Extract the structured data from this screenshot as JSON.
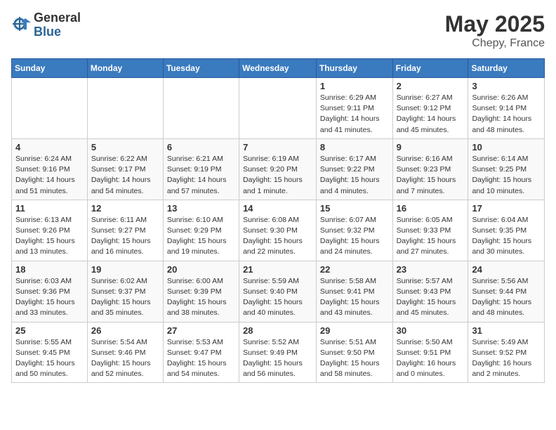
{
  "header": {
    "logo_general": "General",
    "logo_blue": "Blue",
    "month": "May 2025",
    "location": "Chepy, France"
  },
  "weekdays": [
    "Sunday",
    "Monday",
    "Tuesday",
    "Wednesday",
    "Thursday",
    "Friday",
    "Saturday"
  ],
  "weeks": [
    [
      {
        "day": "",
        "detail": ""
      },
      {
        "day": "",
        "detail": ""
      },
      {
        "day": "",
        "detail": ""
      },
      {
        "day": "",
        "detail": ""
      },
      {
        "day": "1",
        "detail": "Sunrise: 6:29 AM\nSunset: 9:11 PM\nDaylight: 14 hours\nand 41 minutes."
      },
      {
        "day": "2",
        "detail": "Sunrise: 6:27 AM\nSunset: 9:12 PM\nDaylight: 14 hours\nand 45 minutes."
      },
      {
        "day": "3",
        "detail": "Sunrise: 6:26 AM\nSunset: 9:14 PM\nDaylight: 14 hours\nand 48 minutes."
      }
    ],
    [
      {
        "day": "4",
        "detail": "Sunrise: 6:24 AM\nSunset: 9:16 PM\nDaylight: 14 hours\nand 51 minutes."
      },
      {
        "day": "5",
        "detail": "Sunrise: 6:22 AM\nSunset: 9:17 PM\nDaylight: 14 hours\nand 54 minutes."
      },
      {
        "day": "6",
        "detail": "Sunrise: 6:21 AM\nSunset: 9:19 PM\nDaylight: 14 hours\nand 57 minutes."
      },
      {
        "day": "7",
        "detail": "Sunrise: 6:19 AM\nSunset: 9:20 PM\nDaylight: 15 hours\nand 1 minute."
      },
      {
        "day": "8",
        "detail": "Sunrise: 6:17 AM\nSunset: 9:22 PM\nDaylight: 15 hours\nand 4 minutes."
      },
      {
        "day": "9",
        "detail": "Sunrise: 6:16 AM\nSunset: 9:23 PM\nDaylight: 15 hours\nand 7 minutes."
      },
      {
        "day": "10",
        "detail": "Sunrise: 6:14 AM\nSunset: 9:25 PM\nDaylight: 15 hours\nand 10 minutes."
      }
    ],
    [
      {
        "day": "11",
        "detail": "Sunrise: 6:13 AM\nSunset: 9:26 PM\nDaylight: 15 hours\nand 13 minutes."
      },
      {
        "day": "12",
        "detail": "Sunrise: 6:11 AM\nSunset: 9:27 PM\nDaylight: 15 hours\nand 16 minutes."
      },
      {
        "day": "13",
        "detail": "Sunrise: 6:10 AM\nSunset: 9:29 PM\nDaylight: 15 hours\nand 19 minutes."
      },
      {
        "day": "14",
        "detail": "Sunrise: 6:08 AM\nSunset: 9:30 PM\nDaylight: 15 hours\nand 22 minutes."
      },
      {
        "day": "15",
        "detail": "Sunrise: 6:07 AM\nSunset: 9:32 PM\nDaylight: 15 hours\nand 24 minutes."
      },
      {
        "day": "16",
        "detail": "Sunrise: 6:05 AM\nSunset: 9:33 PM\nDaylight: 15 hours\nand 27 minutes."
      },
      {
        "day": "17",
        "detail": "Sunrise: 6:04 AM\nSunset: 9:35 PM\nDaylight: 15 hours\nand 30 minutes."
      }
    ],
    [
      {
        "day": "18",
        "detail": "Sunrise: 6:03 AM\nSunset: 9:36 PM\nDaylight: 15 hours\nand 33 minutes."
      },
      {
        "day": "19",
        "detail": "Sunrise: 6:02 AM\nSunset: 9:37 PM\nDaylight: 15 hours\nand 35 minutes."
      },
      {
        "day": "20",
        "detail": "Sunrise: 6:00 AM\nSunset: 9:39 PM\nDaylight: 15 hours\nand 38 minutes."
      },
      {
        "day": "21",
        "detail": "Sunrise: 5:59 AM\nSunset: 9:40 PM\nDaylight: 15 hours\nand 40 minutes."
      },
      {
        "day": "22",
        "detail": "Sunrise: 5:58 AM\nSunset: 9:41 PM\nDaylight: 15 hours\nand 43 minutes."
      },
      {
        "day": "23",
        "detail": "Sunrise: 5:57 AM\nSunset: 9:43 PM\nDaylight: 15 hours\nand 45 minutes."
      },
      {
        "day": "24",
        "detail": "Sunrise: 5:56 AM\nSunset: 9:44 PM\nDaylight: 15 hours\nand 48 minutes."
      }
    ],
    [
      {
        "day": "25",
        "detail": "Sunrise: 5:55 AM\nSunset: 9:45 PM\nDaylight: 15 hours\nand 50 minutes."
      },
      {
        "day": "26",
        "detail": "Sunrise: 5:54 AM\nSunset: 9:46 PM\nDaylight: 15 hours\nand 52 minutes."
      },
      {
        "day": "27",
        "detail": "Sunrise: 5:53 AM\nSunset: 9:47 PM\nDaylight: 15 hours\nand 54 minutes."
      },
      {
        "day": "28",
        "detail": "Sunrise: 5:52 AM\nSunset: 9:49 PM\nDaylight: 15 hours\nand 56 minutes."
      },
      {
        "day": "29",
        "detail": "Sunrise: 5:51 AM\nSunset: 9:50 PM\nDaylight: 15 hours\nand 58 minutes."
      },
      {
        "day": "30",
        "detail": "Sunrise: 5:50 AM\nSunset: 9:51 PM\nDaylight: 16 hours\nand 0 minutes."
      },
      {
        "day": "31",
        "detail": "Sunrise: 5:49 AM\nSunset: 9:52 PM\nDaylight: 16 hours\nand 2 minutes."
      }
    ]
  ]
}
